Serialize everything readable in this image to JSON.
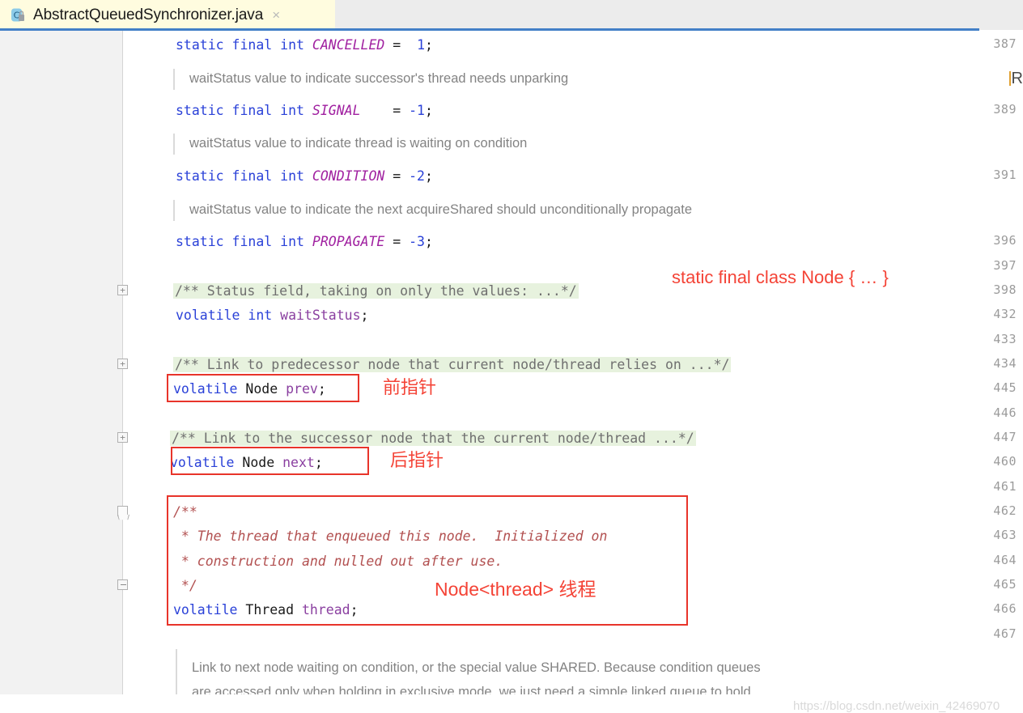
{
  "tab": {
    "label": "AbstractQueuedSynchronizer.java",
    "icon": "java-class-locked-icon",
    "close": "×",
    "accent_color": "#4380c7",
    "background": "#fffcdf"
  },
  "gutter": {
    "line_numbers": [
      387,
      389,
      391,
      396,
      397,
      398,
      432,
      433,
      434,
      445,
      446,
      447,
      460,
      461,
      462,
      463,
      464,
      465,
      466,
      467
    ],
    "fold_markers": [
      {
        "line": 398,
        "type": "expand",
        "glyph": "+"
      },
      {
        "line": 434,
        "type": "expand",
        "glyph": "+"
      },
      {
        "line": 447,
        "type": "expand",
        "glyph": "+"
      },
      {
        "line": 462,
        "type": "region-end",
        "glyph": ""
      },
      {
        "line": 465,
        "type": "collapse",
        "glyph": "-"
      }
    ]
  },
  "code_lines": [
    {
      "id": "l387",
      "tokens": [
        {
          "t": "static",
          "c": "kw"
        },
        {
          "t": " ",
          "c": "punc"
        },
        {
          "t": "final",
          "c": "kw"
        },
        {
          "t": " ",
          "c": "punc"
        },
        {
          "t": "int",
          "c": "kw"
        },
        {
          "t": " ",
          "c": "punc"
        },
        {
          "t": "CANCELLED",
          "c": "cnst"
        },
        {
          "t": " =  ",
          "c": "punc"
        },
        {
          "t": "1",
          "c": "num"
        },
        {
          "t": ";",
          "c": "punc"
        }
      ]
    },
    {
      "id": "l389",
      "tokens": [
        {
          "t": "static",
          "c": "kw"
        },
        {
          "t": " ",
          "c": "punc"
        },
        {
          "t": "final",
          "c": "kw"
        },
        {
          "t": " ",
          "c": "punc"
        },
        {
          "t": "int",
          "c": "kw"
        },
        {
          "t": " ",
          "c": "punc"
        },
        {
          "t": "SIGNAL",
          "c": "cnst"
        },
        {
          "t": "    = ",
          "c": "punc"
        },
        {
          "t": "-1",
          "c": "num"
        },
        {
          "t": ";",
          "c": "punc"
        }
      ]
    },
    {
      "id": "l391",
      "tokens": [
        {
          "t": "static",
          "c": "kw"
        },
        {
          "t": " ",
          "c": "punc"
        },
        {
          "t": "final",
          "c": "kw"
        },
        {
          "t": " ",
          "c": "punc"
        },
        {
          "t": "int",
          "c": "kw"
        },
        {
          "t": " ",
          "c": "punc"
        },
        {
          "t": "CONDITION",
          "c": "cnst"
        },
        {
          "t": " = ",
          "c": "punc"
        },
        {
          "t": "-2",
          "c": "num"
        },
        {
          "t": ";",
          "c": "punc"
        }
      ]
    },
    {
      "id": "l396",
      "tokens": [
        {
          "t": "static",
          "c": "kw"
        },
        {
          "t": " ",
          "c": "punc"
        },
        {
          "t": "final",
          "c": "kw"
        },
        {
          "t": " ",
          "c": "punc"
        },
        {
          "t": "int",
          "c": "kw"
        },
        {
          "t": " ",
          "c": "punc"
        },
        {
          "t": "PROPAGATE",
          "c": "cnst"
        },
        {
          "t": " = ",
          "c": "punc"
        },
        {
          "t": "-3",
          "c": "num"
        },
        {
          "t": ";",
          "c": "punc"
        }
      ]
    },
    {
      "id": "l432",
      "tokens": [
        {
          "t": "volatile",
          "c": "kw"
        },
        {
          "t": " ",
          "c": "punc"
        },
        {
          "t": "int",
          "c": "kw"
        },
        {
          "t": " ",
          "c": "punc"
        },
        {
          "t": "waitStatus",
          "c": "fld"
        },
        {
          "t": ";",
          "c": "punc"
        }
      ]
    },
    {
      "id": "l445",
      "tokens": [
        {
          "t": "volatile",
          "c": "kw"
        },
        {
          "t": " ",
          "c": "punc"
        },
        {
          "t": "Node",
          "c": "typ"
        },
        {
          "t": " ",
          "c": "punc"
        },
        {
          "t": "prev",
          "c": "fld"
        },
        {
          "t": ";",
          "c": "punc"
        }
      ]
    },
    {
      "id": "l460",
      "tokens": [
        {
          "t": "volatile",
          "c": "kw"
        },
        {
          "t": " ",
          "c": "punc"
        },
        {
          "t": "Node",
          "c": "typ"
        },
        {
          "t": " ",
          "c": "punc"
        },
        {
          "t": "next",
          "c": "fld"
        },
        {
          "t": ";",
          "c": "punc"
        }
      ]
    },
    {
      "id": "l462",
      "tokens": [
        {
          "t": "/**",
          "c": "jdoc"
        }
      ]
    },
    {
      "id": "l463",
      "tokens": [
        {
          "t": " * The thread that enqueued this node.  Initialized on",
          "c": "jdoc"
        }
      ]
    },
    {
      "id": "l464",
      "tokens": [
        {
          "t": " * construction and nulled out after use.",
          "c": "jdoc"
        }
      ]
    },
    {
      "id": "l465",
      "tokens": [
        {
          "t": " */",
          "c": "jdoc"
        }
      ]
    },
    {
      "id": "l466",
      "tokens": [
        {
          "t": "volatile",
          "c": "kw"
        },
        {
          "t": " ",
          "c": "punc"
        },
        {
          "t": "Thread",
          "c": "typ"
        },
        {
          "t": " ",
          "c": "punc"
        },
        {
          "t": "thread",
          "c": "fld"
        },
        {
          "t": ";",
          "c": "punc"
        }
      ]
    }
  ],
  "folded_comments": [
    {
      "id": "f398",
      "text": "/** Status field, taking on only the values: ...*/"
    },
    {
      "id": "f434",
      "text": "/** Link to predecessor node that current node/thread relies on ...*/"
    },
    {
      "id": "f447",
      "text": "/** Link to the successor node that the current node/thread ...*/"
    }
  ],
  "rendered_doc_lines": [
    {
      "id": "d388",
      "text": "waitStatus value to indicate successor's thread needs unparking"
    },
    {
      "id": "d390",
      "text": "waitStatus value to indicate thread is waiting on condition"
    },
    {
      "id": "d395",
      "text": "waitStatus value to indicate the next acquireShared should unconditionally propagate"
    },
    {
      "id": "d468a",
      "text": "Link to next node waiting on condition, or the special value SHARED. Because condition queues"
    },
    {
      "id": "d468b",
      "text": "are accessed only when holding in exclusive mode, we just need a simple linked queue to hold"
    }
  ],
  "annotations": [
    {
      "id": "a1",
      "text": "static final class Node { … }",
      "color": "#f44336"
    },
    {
      "id": "a2",
      "text": "前指针",
      "color": "#f44336"
    },
    {
      "id": "a3",
      "text": "后指针",
      "color": "#f44336"
    },
    {
      "id": "a4",
      "text": "Node<thread> 线程",
      "color": "#f44336"
    }
  ],
  "edge_glyph": "R",
  "watermark": "https://blog.csdn.net/weixin_42469070",
  "colors": {
    "keyword": "#2a41d8",
    "constant": "#a020a0",
    "field": "#8a3fa0",
    "javadoc": "#b25050",
    "folded_bg": "#e7f2de",
    "annotation_red": "#f44336",
    "box_red": "#e8342a",
    "gutter_bg": "#f2f2f2",
    "tab_bg": "#fffcdf"
  }
}
